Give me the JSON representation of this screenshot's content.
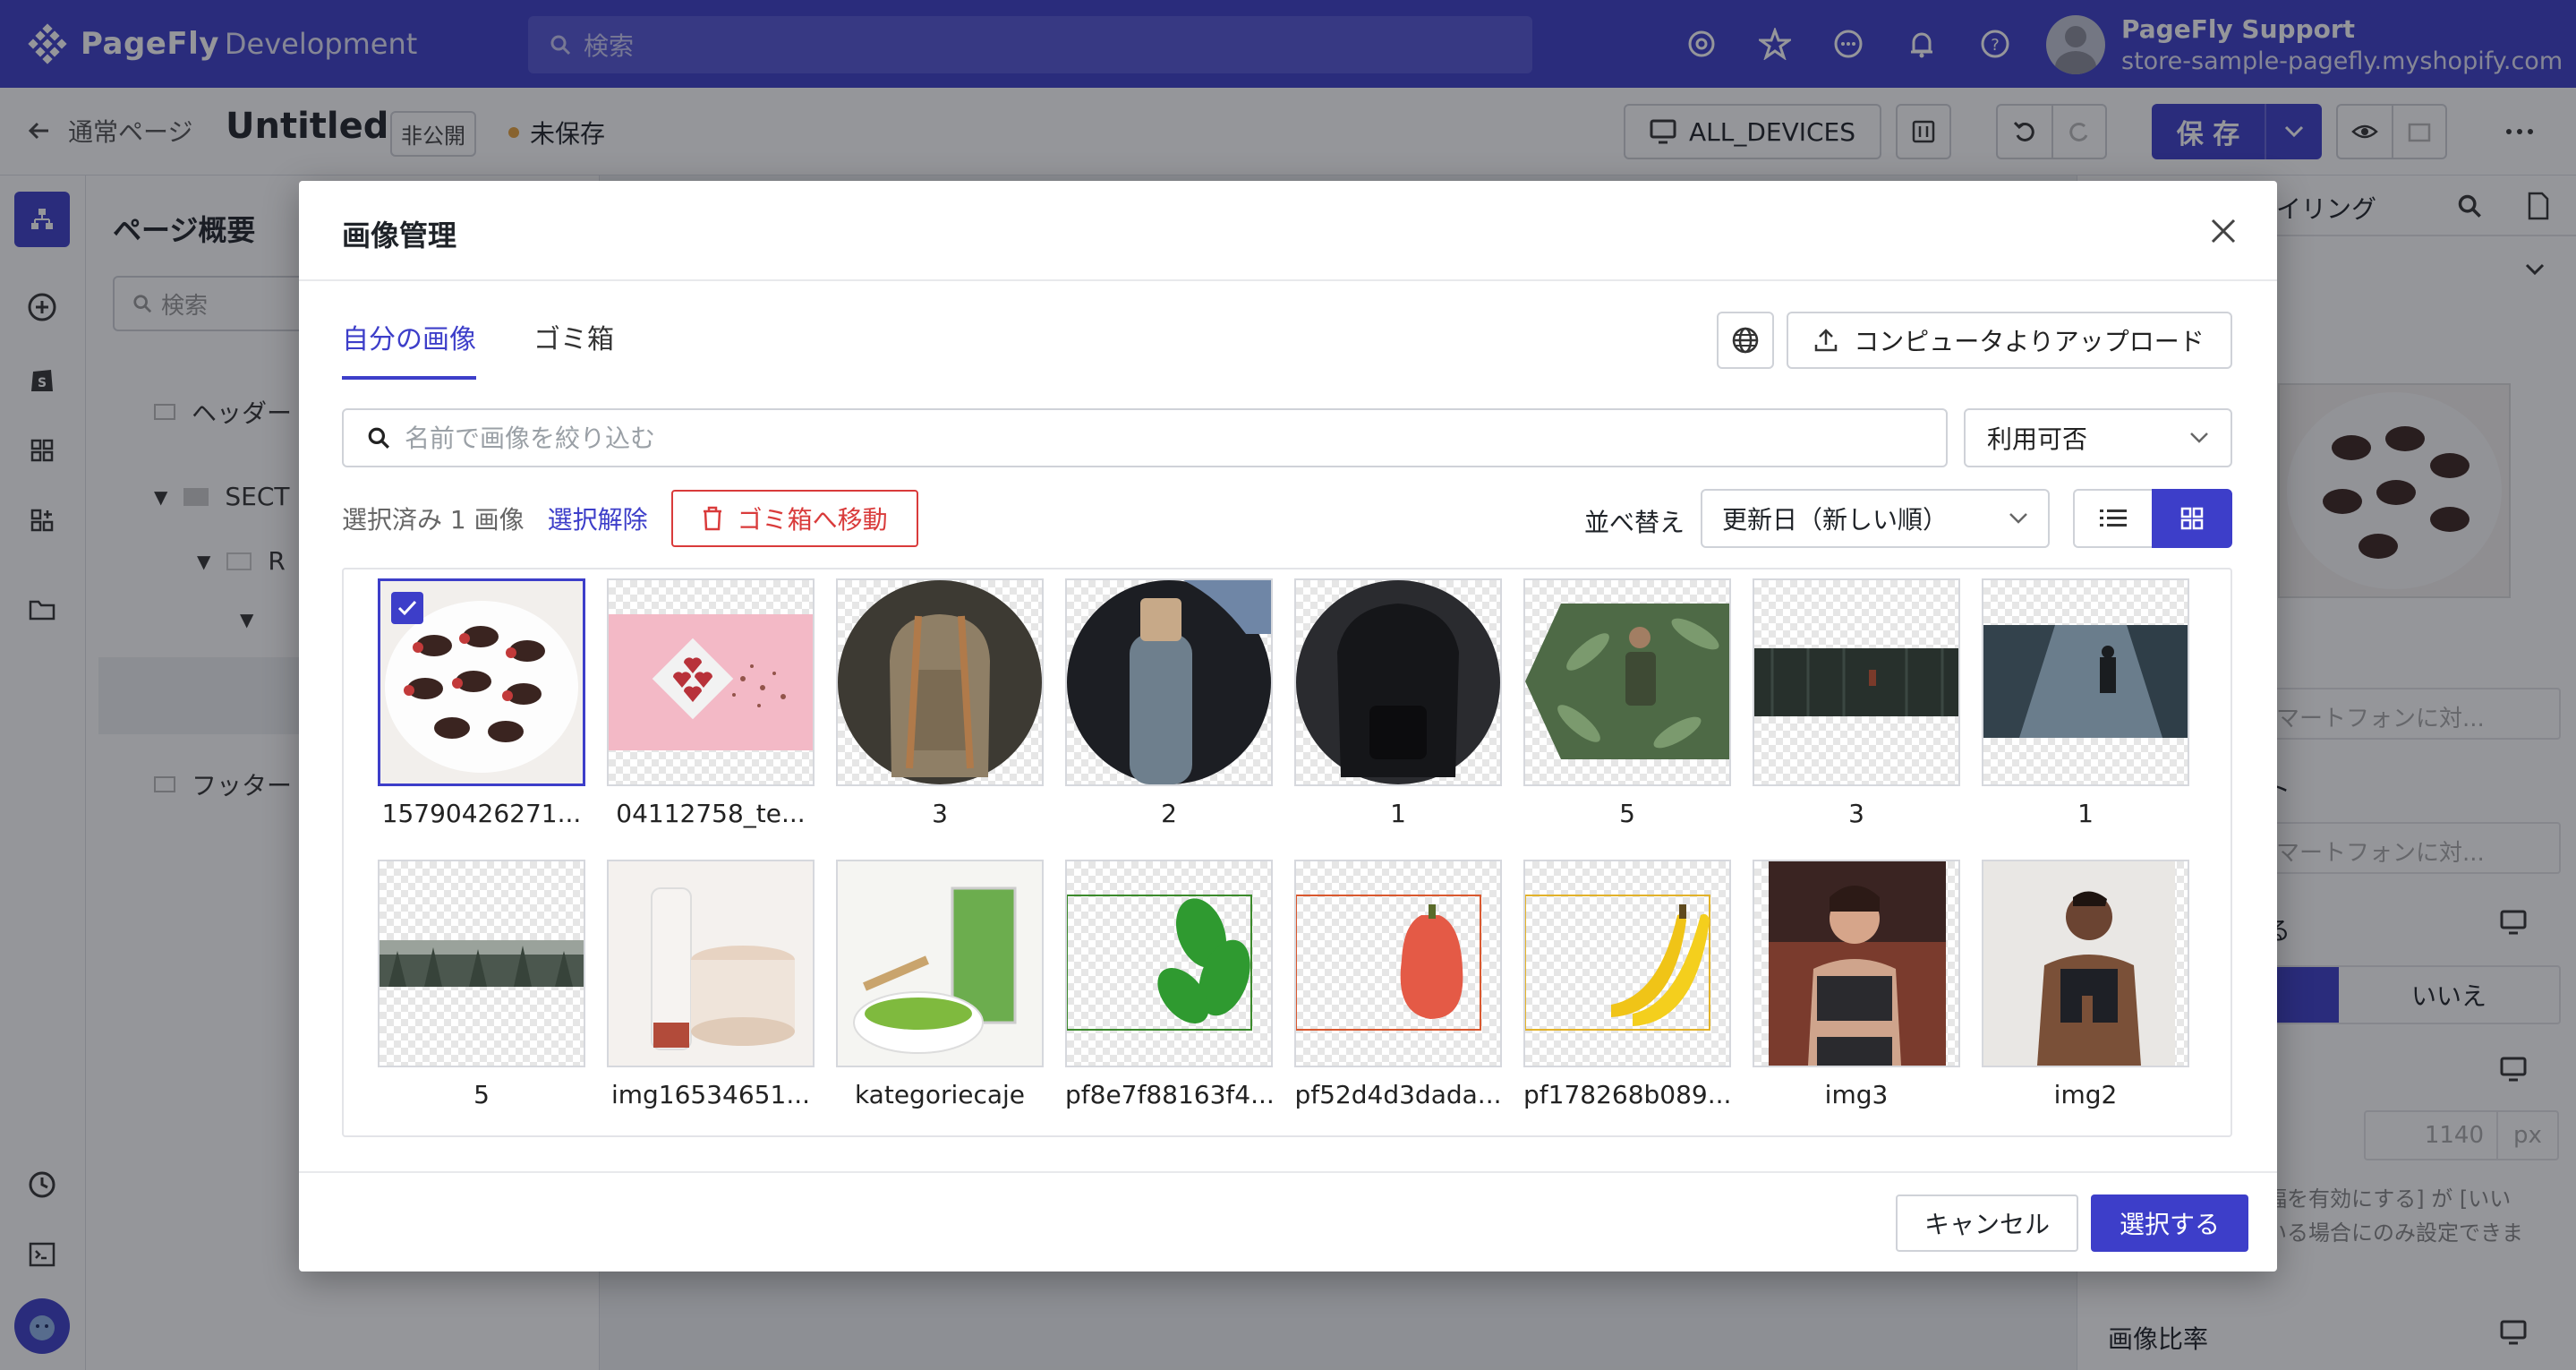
{
  "topbar": {
    "brand": "PageFly",
    "brand_sub": "Development",
    "search_placeholder": "検索",
    "user_name": "PageFly Support",
    "user_store": "store-sample-pagefly.myshopify.com"
  },
  "subbar": {
    "back_label": "通常ページ",
    "page_title": "Untitled",
    "visibility_badge": "非公開",
    "save_state": "未保存",
    "devices_label": "ALL_DEVICES",
    "save_label": "保 存"
  },
  "outline": {
    "title": "ページ概要",
    "search_placeholder": "検索",
    "rows": [
      "ヘッダー",
      "SECT",
      "R",
      "フッター"
    ]
  },
  "right_panel": {
    "tab_label": "イリング",
    "field_placeholder_1": "マートフォンに対...",
    "label_2": "ト",
    "field_placeholder_2": "マートフォンに対...",
    "label_3": "る",
    "no_label": "いいえ",
    "width_value": "1140",
    "unit": "px",
    "hint_1": "幅を有効にする] が [いい",
    "hint_2": "いる場合にのみ設定できま",
    "aspect_label": "画像比率"
  },
  "modal": {
    "title": "画像管理",
    "tabs": [
      {
        "label": "自分の画像",
        "active": true
      },
      {
        "label": "ゴミ箱",
        "active": false
      }
    ],
    "upload_label": "コンピュータよりアップロード",
    "filter_placeholder": "名前で画像を絞り込む",
    "availability_label": "利用可否",
    "selected_count": "選択済み 1 画像",
    "deselect_label": "選択解除",
    "trash_label": "ゴミ箱へ移動",
    "sort_label": "並べ替え",
    "sort_value": "更新日（新しい順）",
    "images": [
      {
        "caption": "15790426271...",
        "selected": true
      },
      {
        "caption": "04112758_te...",
        "selected": false
      },
      {
        "caption": "3",
        "selected": false
      },
      {
        "caption": "2",
        "selected": false
      },
      {
        "caption": "1",
        "selected": false
      },
      {
        "caption": "5",
        "selected": false
      },
      {
        "caption": "3",
        "selected": false
      },
      {
        "caption": "1",
        "selected": false
      },
      {
        "caption": "5",
        "selected": false
      },
      {
        "caption": "img16534651...",
        "selected": false
      },
      {
        "caption": "kategoriecaje",
        "selected": false
      },
      {
        "caption": "pf8e7f88163f4...",
        "selected": false
      },
      {
        "caption": "pf52d4d3dada...",
        "selected": false
      },
      {
        "caption": "pf178268b089...",
        "selected": false
      },
      {
        "caption": "img3",
        "selected": false
      },
      {
        "caption": "img2",
        "selected": false
      }
    ],
    "cancel_label": "キャンセル",
    "select_label": "選択する"
  },
  "colors": {
    "brand": "#3d3ec9",
    "danger": "#d93b3b",
    "unsaved_dot": "#e8a33d"
  }
}
